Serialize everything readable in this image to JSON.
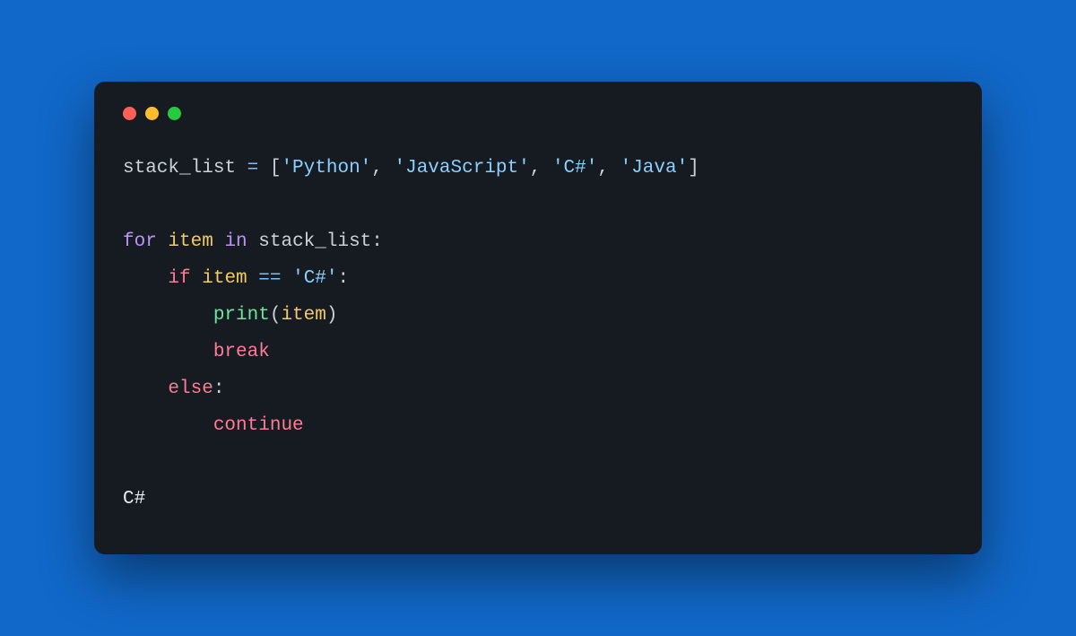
{
  "titlebar": {
    "close_color": "#ff5f56",
    "minimize_color": "#ffbd2e",
    "zoom_color": "#27c93f"
  },
  "code": {
    "l1_var": "stack_list",
    "l1_eq": " = ",
    "l1_br_open": "[",
    "l1_s1": "'Python'",
    "l1_c1": ", ",
    "l1_s2": "'JavaScript'",
    "l1_c2": ", ",
    "l1_s3": "'C#'",
    "l1_c3": ", ",
    "l1_s4": "'Java'",
    "l1_br_close": "]",
    "l2": "",
    "l3_for": "for",
    "l3_item": " item ",
    "l3_in": "in",
    "l3_list": " stack_list",
    "l3_colon": ":",
    "l4_indent": "    ",
    "l4_if": "if",
    "l4_item": " item ",
    "l4_eqeq": "==",
    "l4_sp": " ",
    "l4_str": "'C#'",
    "l4_colon": ":",
    "l5_indent": "        ",
    "l5_print": "print",
    "l5_paren_open": "(",
    "l5_arg": "item",
    "l5_paren_close": ")",
    "l6_indent": "        ",
    "l6_break": "break",
    "l7_indent": "    ",
    "l7_else": "else",
    "l7_colon": ":",
    "l8_indent": "        ",
    "l8_continue": "continue",
    "l9": "",
    "l10_output": "C#"
  }
}
